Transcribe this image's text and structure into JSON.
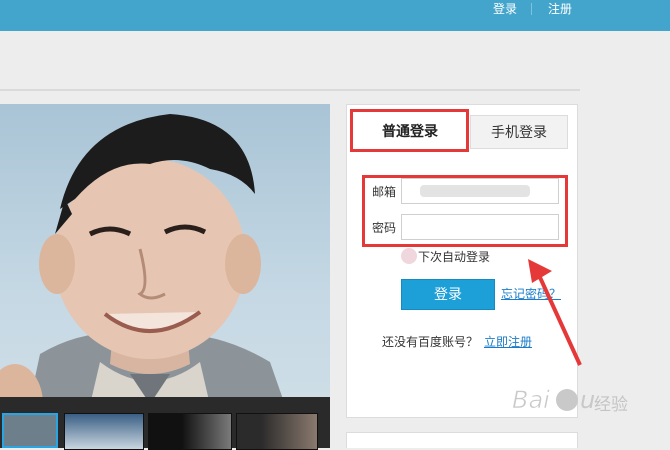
{
  "topbar": {
    "login_link": "登录",
    "register_link": "注册"
  },
  "login": {
    "tabs": [
      {
        "label": "普通登录",
        "active": true
      },
      {
        "label": "手机登录",
        "active": false
      }
    ],
    "email_label": "邮箱",
    "password_label": "密码",
    "remember_label": "下次自动登录",
    "submit_label": "登录",
    "forgot_label": "忘记密码？",
    "no_account_text": "还没有百度账号？",
    "register_now": "立即注册"
  },
  "watermark": "经验",
  "colors": {
    "topbar": "#43a5cb",
    "accent_red": "#e53838",
    "button_blue": "#1d9fd8",
    "link_blue": "#1a7cc8"
  }
}
